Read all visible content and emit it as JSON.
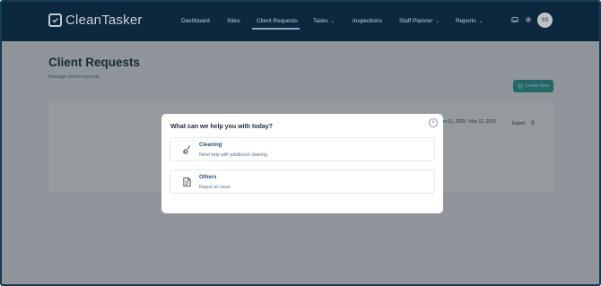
{
  "app": {
    "name": "CleanTasker"
  },
  "nav": {
    "items": [
      {
        "label": "Dashboard"
      },
      {
        "label": "Sites"
      },
      {
        "label": "Client Requests"
      },
      {
        "label": "Tasks"
      },
      {
        "label": "Inspections"
      },
      {
        "label": "Staff Planner"
      },
      {
        "label": "Reports"
      }
    ],
    "avatar_initials": "SS"
  },
  "page": {
    "title": "Client Requests",
    "subtitle": "Manage client requests",
    "create_label": "Create New",
    "date_range": "Nov 01, 2025 - Nov 12, 2025",
    "export_label": "Export"
  },
  "modal": {
    "title": "What can we help you with today?",
    "close_glyph": "×",
    "options": [
      {
        "title": "Cleaning",
        "description": "Need help with additional cleaning",
        "icon": "broom-icon"
      },
      {
        "title": "Others",
        "description": "Report an issue",
        "icon": "document-icon"
      }
    ]
  },
  "colors": {
    "navbar": "#0f2f4a",
    "accent": "#2aa79b",
    "option_title": "#2a4f70"
  }
}
